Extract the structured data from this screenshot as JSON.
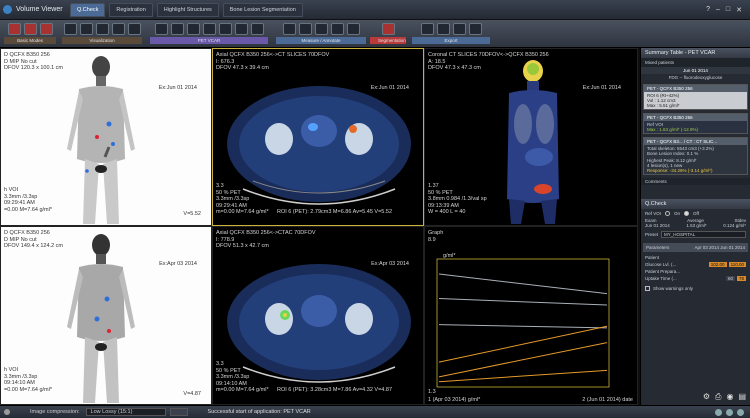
{
  "app": {
    "title": "Volume Viewer"
  },
  "tabs": [
    {
      "label": "Q.Check"
    },
    {
      "label": "Registration"
    },
    {
      "label": "Highlight Structures"
    },
    {
      "label": "Bone Lesion Segmentation"
    }
  ],
  "toolbar": {
    "groups": [
      "Basic Modes",
      "Visualization",
      "PET VCAR",
      "Measure / Annotate",
      "Segmentation",
      "Export"
    ]
  },
  "viewports": {
    "mip_top": {
      "lines": [
        "D QCFX B350 256",
        "D MIP No cut",
        "DFOV 120.3 x 100.1 cm"
      ],
      "date": "Ex:Jun 01 2014",
      "bl": [
        "h VOI",
        "3.3mm /3.3sp",
        "09:29:41 AM",
        "=0.00 M=7.64 g/ml*"
      ],
      "br": "V=5.52"
    },
    "axial_top": {
      "lines": [
        "Axial QCFX B350 256<->CT SLICES 70DFOV",
        "I: 676.3",
        "DFOV 47.3 x 39.4 cm"
      ],
      "date": "Ex:Jun 01 2014",
      "bl": [
        "3.3",
        "50 % PET",
        "3.3mm /3.3sp",
        "09:29:41 AM",
        "m=0.00 M=7.64 g/ml*"
      ],
      "roi": "ROI 6 (PET): 2.79cm3 M=6.86 Av=5.45 V=5.52"
    },
    "coronal": {
      "lines": [
        "Coronal CT SLICES 70DFOV<->QCFX B350 256",
        "A: 18.5",
        "DFOV 47.3 x 47.3 cm"
      ],
      "date": "Ex:Jun 01 2014",
      "bl": [
        "1.37",
        "50 % PET",
        "3.8mm 0.984 /1.3/val sp",
        "09:13:39 AM",
        "W = 400 L = 40"
      ]
    },
    "mip_bottom": {
      "lines": [
        "D QCFX B350 256",
        "D MIP No cut",
        "DFOV 149.4 x 124.2 cm"
      ],
      "date": "Ex:Apr 03 2014",
      "bl": [
        "h VOI",
        "3.3mm /3.3sp",
        "09:14:10 AM",
        "=0.00 M=7.64 g/ml*"
      ],
      "br": "V=4.87"
    },
    "axial_bottom": {
      "lines": [
        "Axial QCFX B350 256<->CTAC 70DFOV",
        "I: 778.9",
        "DFOV 51.3 x 42.7 cm"
      ],
      "date": "Ex:Apr 03 2014",
      "bl": [
        "3.3",
        "50 % PET",
        "3.3mm /3.3sp",
        "09:14:10 AM",
        "m=0.00 M=7.64 g/ml*"
      ],
      "roi": "ROI 6 (PET): 3.28cm3 M=7.86 Av=4.32 V=4.87"
    },
    "graph": {
      "title": "Graph",
      "value": "8.9",
      "unit": "g/ml*",
      "xstart": "1 (Apr 03 2014) g/ml*",
      "xend": "2 (Jun 01 2014) date",
      "ymin": "1.3"
    }
  },
  "chart_data": {
    "type": "line",
    "title": "Graph",
    "x": [
      "1 (Apr 03 2014)",
      "2 (Jun 01 2014)"
    ],
    "series": [
      {
        "values": [
          8.1,
          6.9
        ],
        "color": "#aab0b8"
      },
      {
        "values": [
          6.6,
          6.2
        ],
        "color": "#aab0b8"
      },
      {
        "values": [
          5.0,
          4.8
        ],
        "color": "#aab0b8"
      },
      {
        "values": [
          2.7,
          4.9
        ],
        "color": "#e59a2a"
      },
      {
        "values": [
          1.8,
          3.9
        ],
        "color": "#e59a2a"
      },
      {
        "values": [
          1.5,
          2.2
        ],
        "color": "#e59a2a"
      }
    ],
    "ylim": [
      1.3,
      8.9
    ]
  },
  "panel": {
    "summary_title": "Summary Table - PET VCAR",
    "mixed": "Mixed patients",
    "date": "Jun 01 2014",
    "tracer": "FDG -- fluorodeoxyglucose",
    "rows": [
      {
        "head": "PET - QCFX B350 256",
        "l1": "ROI 6 (Rt~42%)",
        "l2": "Vol : 1.12 cm3",
        "l3": "Max : 5.51 g/ml*"
      },
      {
        "head": "PET - QCFX B350 256",
        "l1": "Ref VOI",
        "l2": "Max : 1.63 g/ml* (-12.9%)",
        "l3": ""
      }
    ],
    "ct_head": "PET - QCFX B3... / CT : CT SLIC...",
    "ct_lines": [
      "Total skeleton: 5543 cm3  (+3.2%)",
      "Bone Lesion Index:  0.1 %"
    ],
    "peak_lines": [
      "Highest Peak: 8.12 g/ml*",
      "4 lesion(s), 1 new",
      "Response: -34.26% (-3.14 g/ml*)"
    ],
    "comments": "Comments",
    "qcheck_title": "Q.Check",
    "ref_voi": "Ref VOI",
    "on": "On",
    "off": "Off",
    "cols": [
      "Exam",
      "Average",
      "Stdev"
    ],
    "exam_row": [
      "Jun 01 2014",
      "1.53 g/ml*",
      "0.124 g/ml*"
    ],
    "preset_label": "Preset",
    "preset_value": "MY_HOSPITAL",
    "params_label": "Parameters",
    "params_dates": "Apr 03 2014  Jun 01 2014",
    "patient": "Patient",
    "glucose": "Glucose Lvl. (...",
    "glucose_v1": "102.00",
    "glucose_v2": "110.00",
    "prep": "Patient Prepara...",
    "uptake": "Uptake Time (...",
    "uptake_v1": "60",
    "uptake_v2": "78",
    "warnings": "Show warnings only"
  },
  "status": {
    "compression_label": "Image compression:",
    "compression_value": "Low Lossy (15:1)",
    "message": "Successful start of application: PET VCAR"
  }
}
